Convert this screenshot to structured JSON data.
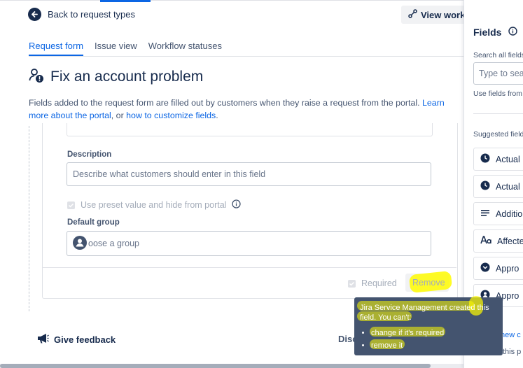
{
  "nav": {
    "back_label": "Back to request types",
    "view_workflow_label": "View workfl"
  },
  "tabs": [
    {
      "label": "Request form",
      "active": true
    },
    {
      "label": "Issue view",
      "active": false
    },
    {
      "label": "Workflow statuses",
      "active": false
    }
  ],
  "page": {
    "title": "Fix an account problem",
    "desc_prefix": "Fields added to the request form are filled out by customers when they raise a request from the portal.",
    "desc_link1": "Learn more about the portal",
    "desc_mid": ", or",
    "desc_link2": "how to customize fields",
    "desc_end": "."
  },
  "form": {
    "description_label": "Description",
    "description_placeholder": "Describe what customers should enter in this field",
    "preset_checkbox_label": "Use preset value and hide from portal",
    "default_group_label": "Default group",
    "default_group_placeholder": "oose a group",
    "required_label": "Required",
    "remove_label": "Remove"
  },
  "tooltip": {
    "line1": "Jira Service Management created this",
    "line2": "field. You can't:",
    "items": [
      "change if it's required",
      "remove it"
    ]
  },
  "footer": {
    "feedback_label": "Give feedback",
    "discard_label": "Disc"
  },
  "right_panel": {
    "title": "Fields",
    "search_label": "Search all fields",
    "search_placeholder": "Type to sear",
    "use_fields_label": "Use fields from",
    "suggested_label": "Suggested field",
    "items": [
      {
        "icon": "clock-icon",
        "label": "Actual"
      },
      {
        "icon": "clock-icon",
        "label": "Actual"
      },
      {
        "icon": "lines-icon",
        "label": "Additio"
      },
      {
        "icon": "text-icon",
        "label": "Affecte"
      },
      {
        "icon": "chevron-circle-icon",
        "label": "Appro"
      },
      {
        "icon": "user-circle-icon",
        "label": "Appro"
      }
    ],
    "create_link": "new c",
    "this_text": "this p"
  },
  "colors": {
    "accent": "#0c66e4",
    "tooltip_bg": "#44546f",
    "highlight": "#fffb00"
  }
}
